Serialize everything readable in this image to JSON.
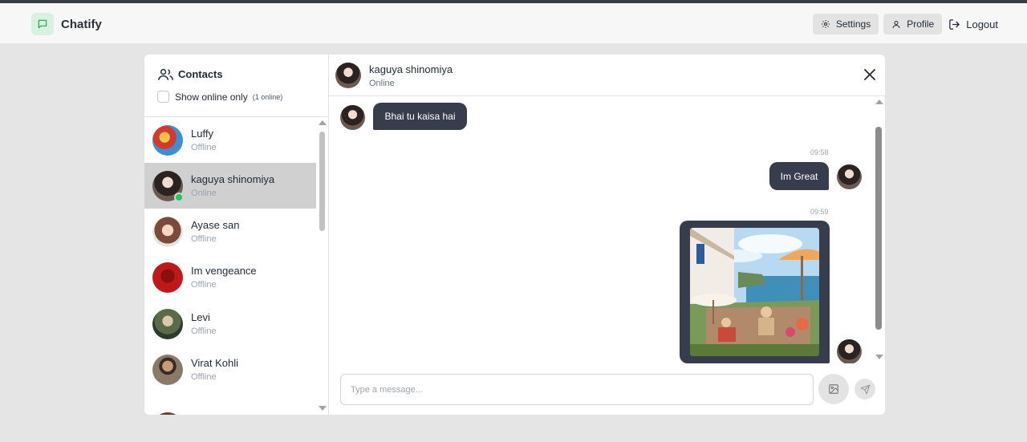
{
  "app": {
    "name": "Chatify"
  },
  "navbar": {
    "settings_label": "Settings",
    "profile_label": "Profile",
    "logout_label": "Logout"
  },
  "sidebar": {
    "title": "Contacts",
    "filter_label": "Show online only",
    "online_count": "(1 online)",
    "contacts": [
      {
        "name": "Luffy",
        "status": "Offline",
        "avatar_color": "#3a8fd6"
      },
      {
        "name": "kaguya shinomiya",
        "status": "Online",
        "avatar_color": "#4a3b36"
      },
      {
        "name": "Ayase san",
        "status": "Offline",
        "avatar_color": "#7a4a3a"
      },
      {
        "name": "Im vengeance",
        "status": "Offline",
        "avatar_color": "#c01818"
      },
      {
        "name": "Levi",
        "status": "Offline",
        "avatar_color": "#5b6b4a"
      },
      {
        "name": "Virat Kohli",
        "status": "Offline",
        "avatar_color": "#8a7a6a"
      }
    ]
  },
  "chat": {
    "contact_name": "kaguya shinomiya",
    "contact_status": "Online",
    "messages": [
      {
        "text": "Bhai tu kaisa hai",
        "time": ""
      },
      {
        "text": "Im Great",
        "time": "09:58"
      },
      {
        "text": "",
        "time": "09:59",
        "kind": "image"
      }
    ],
    "input_placeholder": "Type a message..."
  },
  "colors": {
    "bubble": "#373d4d",
    "online": "#22c55e",
    "brand_bg": "#d7f3df",
    "brand_icon": "#22a352"
  }
}
